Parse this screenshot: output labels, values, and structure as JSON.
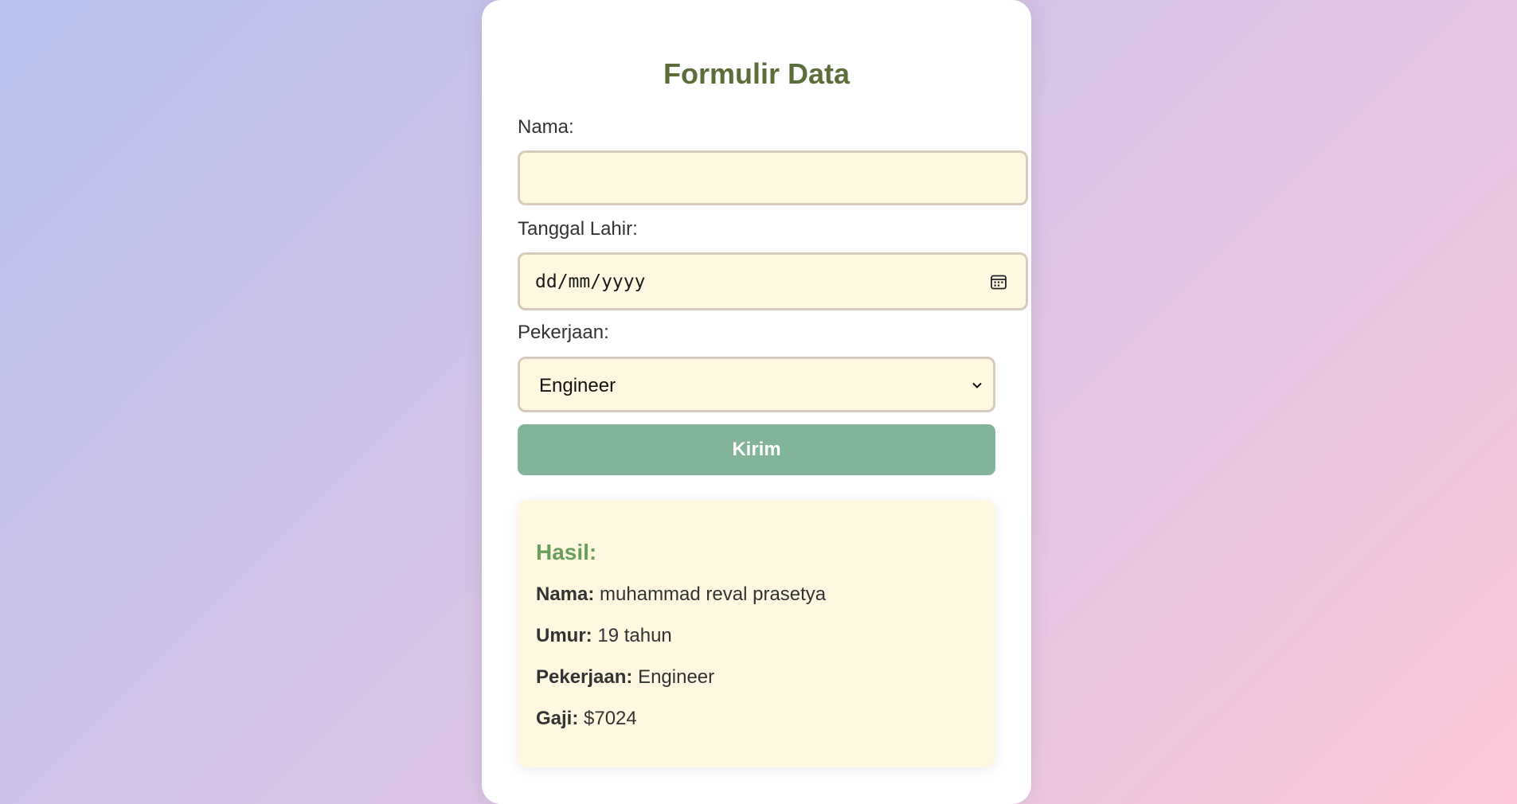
{
  "form": {
    "title": "Formulir Data",
    "name_label": "Nama:",
    "name_value": "",
    "dob_label": "Tanggal Lahir:",
    "dob_placeholder": "dd/mm/yyyy",
    "job_label": "Pekerjaan:",
    "job_selected": "Engineer",
    "submit_label": "Kirim"
  },
  "result": {
    "title": "Hasil:",
    "rows": [
      {
        "label": "Nama:",
        "value": "muhammad reval prasetya"
      },
      {
        "label": "Umur:",
        "value": "19 tahun"
      },
      {
        "label": "Pekerjaan:",
        "value": "Engineer"
      },
      {
        "label": "Gaji:",
        "value": "$7024"
      }
    ]
  },
  "colors": {
    "title": "#5b6e3a",
    "field_bg": "#fdf8df",
    "button_bg": "#82b49a",
    "result_title": "#6a9f5a"
  },
  "icons": {
    "date": "calendar-icon",
    "select": "chevron-down-icon"
  }
}
